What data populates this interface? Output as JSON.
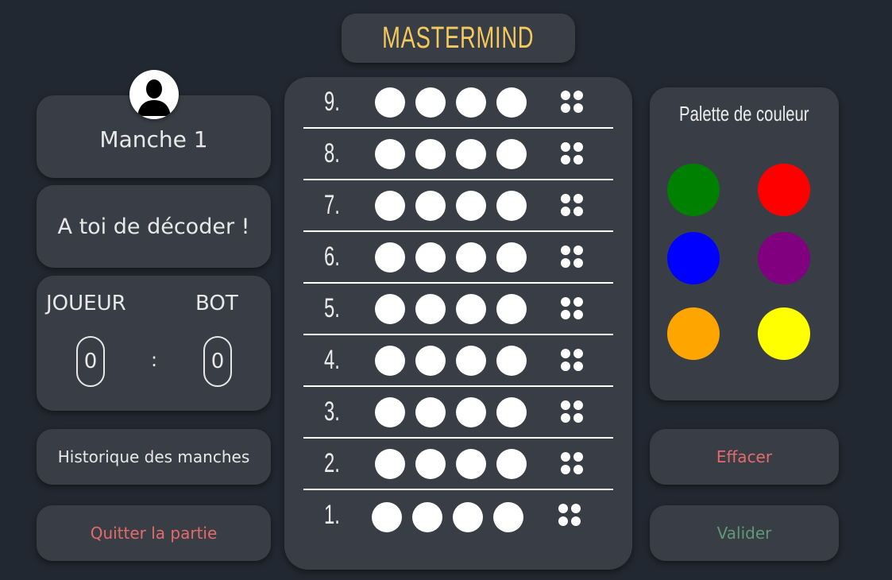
{
  "header": {
    "title": "MASTERMIND"
  },
  "round": {
    "label": "Manche 1",
    "avatar_icon": "user-silhouette-icon"
  },
  "status": {
    "message": "A toi de décoder !"
  },
  "score": {
    "player_label": "JOUEUR",
    "bot_label": "BOT",
    "player_score": "0",
    "separator": ":",
    "bot_score": "0"
  },
  "actions": {
    "history_label": "Historique des manches",
    "quit_label": "Quitter la partie",
    "erase_label": "Effacer",
    "validate_label": "Valider"
  },
  "board": {
    "rows": [
      {
        "number": "9."
      },
      {
        "number": "8."
      },
      {
        "number": "7."
      },
      {
        "number": "6."
      },
      {
        "number": "5."
      },
      {
        "number": "4."
      },
      {
        "number": "3."
      },
      {
        "number": "2."
      },
      {
        "number": "1."
      }
    ],
    "peg_color": "#ffffff",
    "feedback_pin_color": "#ffffff"
  },
  "palette": {
    "title": "Palette de couleur",
    "colors": [
      {
        "name": "green",
        "hex": "#008000"
      },
      {
        "name": "red",
        "hex": "#ff0000"
      },
      {
        "name": "blue",
        "hex": "#0000ff"
      },
      {
        "name": "purple",
        "hex": "#800080"
      },
      {
        "name": "orange",
        "hex": "#ffa500"
      },
      {
        "name": "yellow",
        "hex": "#ffff00"
      }
    ]
  },
  "theme": {
    "background": "#222831",
    "panel": "#393e46",
    "title_color": "#f4c95d",
    "danger_text": "#e36b6b",
    "success_text": "#5f9a74"
  }
}
